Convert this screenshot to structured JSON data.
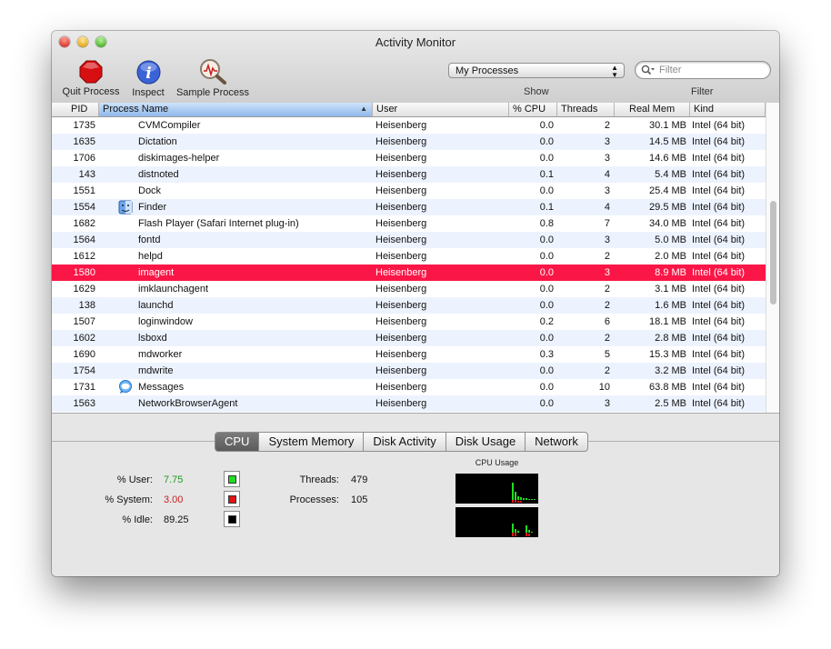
{
  "window": {
    "title": "Activity Monitor"
  },
  "toolbar": {
    "quit_label": "Quit Process",
    "inspect_label": "Inspect",
    "sample_label": "Sample Process",
    "show_selected": "My Processes",
    "show_label": "Show",
    "filter_placeholder": "Filter",
    "filter_label": "Filter"
  },
  "table": {
    "columns": {
      "pid": "PID",
      "name": "Process Name",
      "user": "User",
      "cpu": "% CPU",
      "threads": "Threads",
      "mem": "Real Mem",
      "kind": "Kind"
    },
    "sorted_column": "Process Name",
    "selected_pid": "1580",
    "rows": [
      {
        "pid": "1735",
        "name": "CVMCompiler",
        "user": "Heisenberg",
        "cpu": "0.0",
        "threads": "2",
        "mem": "30.1 MB",
        "kind": "Intel (64 bit)",
        "icon": ""
      },
      {
        "pid": "1635",
        "name": "Dictation",
        "user": "Heisenberg",
        "cpu": "0.0",
        "threads": "3",
        "mem": "14.5 MB",
        "kind": "Intel (64 bit)",
        "icon": ""
      },
      {
        "pid": "1706",
        "name": "diskimages-helper",
        "user": "Heisenberg",
        "cpu": "0.0",
        "threads": "3",
        "mem": "14.6 MB",
        "kind": "Intel (64 bit)",
        "icon": ""
      },
      {
        "pid": "143",
        "name": "distnoted",
        "user": "Heisenberg",
        "cpu": "0.1",
        "threads": "4",
        "mem": "5.4 MB",
        "kind": "Intel (64 bit)",
        "icon": ""
      },
      {
        "pid": "1551",
        "name": "Dock",
        "user": "Heisenberg",
        "cpu": "0.0",
        "threads": "3",
        "mem": "25.4 MB",
        "kind": "Intel (64 bit)",
        "icon": ""
      },
      {
        "pid": "1554",
        "name": "Finder",
        "user": "Heisenberg",
        "cpu": "0.1",
        "threads": "4",
        "mem": "29.5 MB",
        "kind": "Intel (64 bit)",
        "icon": "finder-icon"
      },
      {
        "pid": "1682",
        "name": "Flash Player (Safari Internet plug-in)",
        "user": "Heisenberg",
        "cpu": "0.8",
        "threads": "7",
        "mem": "34.0 MB",
        "kind": "Intel (64 bit)",
        "icon": ""
      },
      {
        "pid": "1564",
        "name": "fontd",
        "user": "Heisenberg",
        "cpu": "0.0",
        "threads": "3",
        "mem": "5.0 MB",
        "kind": "Intel (64 bit)",
        "icon": ""
      },
      {
        "pid": "1612",
        "name": "helpd",
        "user": "Heisenberg",
        "cpu": "0.0",
        "threads": "2",
        "mem": "2.0 MB",
        "kind": "Intel (64 bit)",
        "icon": ""
      },
      {
        "pid": "1580",
        "name": "imagent",
        "user": "Heisenberg",
        "cpu": "0.0",
        "threads": "3",
        "mem": "8.9 MB",
        "kind": "Intel (64 bit)",
        "icon": ""
      },
      {
        "pid": "1629",
        "name": "imklaunchagent",
        "user": "Heisenberg",
        "cpu": "0.0",
        "threads": "2",
        "mem": "3.1 MB",
        "kind": "Intel (64 bit)",
        "icon": ""
      },
      {
        "pid": "138",
        "name": "launchd",
        "user": "Heisenberg",
        "cpu": "0.0",
        "threads": "2",
        "mem": "1.6 MB",
        "kind": "Intel (64 bit)",
        "icon": ""
      },
      {
        "pid": "1507",
        "name": "loginwindow",
        "user": "Heisenberg",
        "cpu": "0.2",
        "threads": "6",
        "mem": "18.1 MB",
        "kind": "Intel (64 bit)",
        "icon": ""
      },
      {
        "pid": "1602",
        "name": "lsboxd",
        "user": "Heisenberg",
        "cpu": "0.0",
        "threads": "2",
        "mem": "2.8 MB",
        "kind": "Intel (64 bit)",
        "icon": ""
      },
      {
        "pid": "1690",
        "name": "mdworker",
        "user": "Heisenberg",
        "cpu": "0.3",
        "threads": "5",
        "mem": "15.3 MB",
        "kind": "Intel (64 bit)",
        "icon": ""
      },
      {
        "pid": "1754",
        "name": "mdwrite",
        "user": "Heisenberg",
        "cpu": "0.0",
        "threads": "2",
        "mem": "3.2 MB",
        "kind": "Intel (64 bit)",
        "icon": ""
      },
      {
        "pid": "1731",
        "name": "Messages",
        "user": "Heisenberg",
        "cpu": "0.0",
        "threads": "10",
        "mem": "63.8 MB",
        "kind": "Intel (64 bit)",
        "icon": "messages-icon"
      },
      {
        "pid": "1563",
        "name": "NetworkBrowserAgent",
        "user": "Heisenberg",
        "cpu": "0.0",
        "threads": "3",
        "mem": "2.5 MB",
        "kind": "Intel (64 bit)",
        "icon": ""
      }
    ]
  },
  "tabs": [
    {
      "label": "CPU",
      "active": true
    },
    {
      "label": "System Memory",
      "active": false
    },
    {
      "label": "Disk Activity",
      "active": false
    },
    {
      "label": "Disk Usage",
      "active": false
    },
    {
      "label": "Network",
      "active": false
    }
  ],
  "cpu_panel": {
    "user_label": "% User:",
    "user_value": "7.75",
    "user_color": "#1f9b1f",
    "user_swatch": "#22dd22",
    "system_label": "% System:",
    "system_value": "3.00",
    "system_color": "#c81e1e",
    "system_swatch": "#e01515",
    "idle_label": "% Idle:",
    "idle_value": "89.25",
    "idle_swatch": "#000000",
    "threads_label": "Threads:",
    "threads_value": "479",
    "processes_label": "Processes:",
    "processes_value": "105",
    "usage_title": "CPU Usage"
  },
  "icons": {
    "quit": "stop-octagon-icon",
    "inspect": "info-icon",
    "sample": "magnifier-icon",
    "search": "search-icon"
  }
}
